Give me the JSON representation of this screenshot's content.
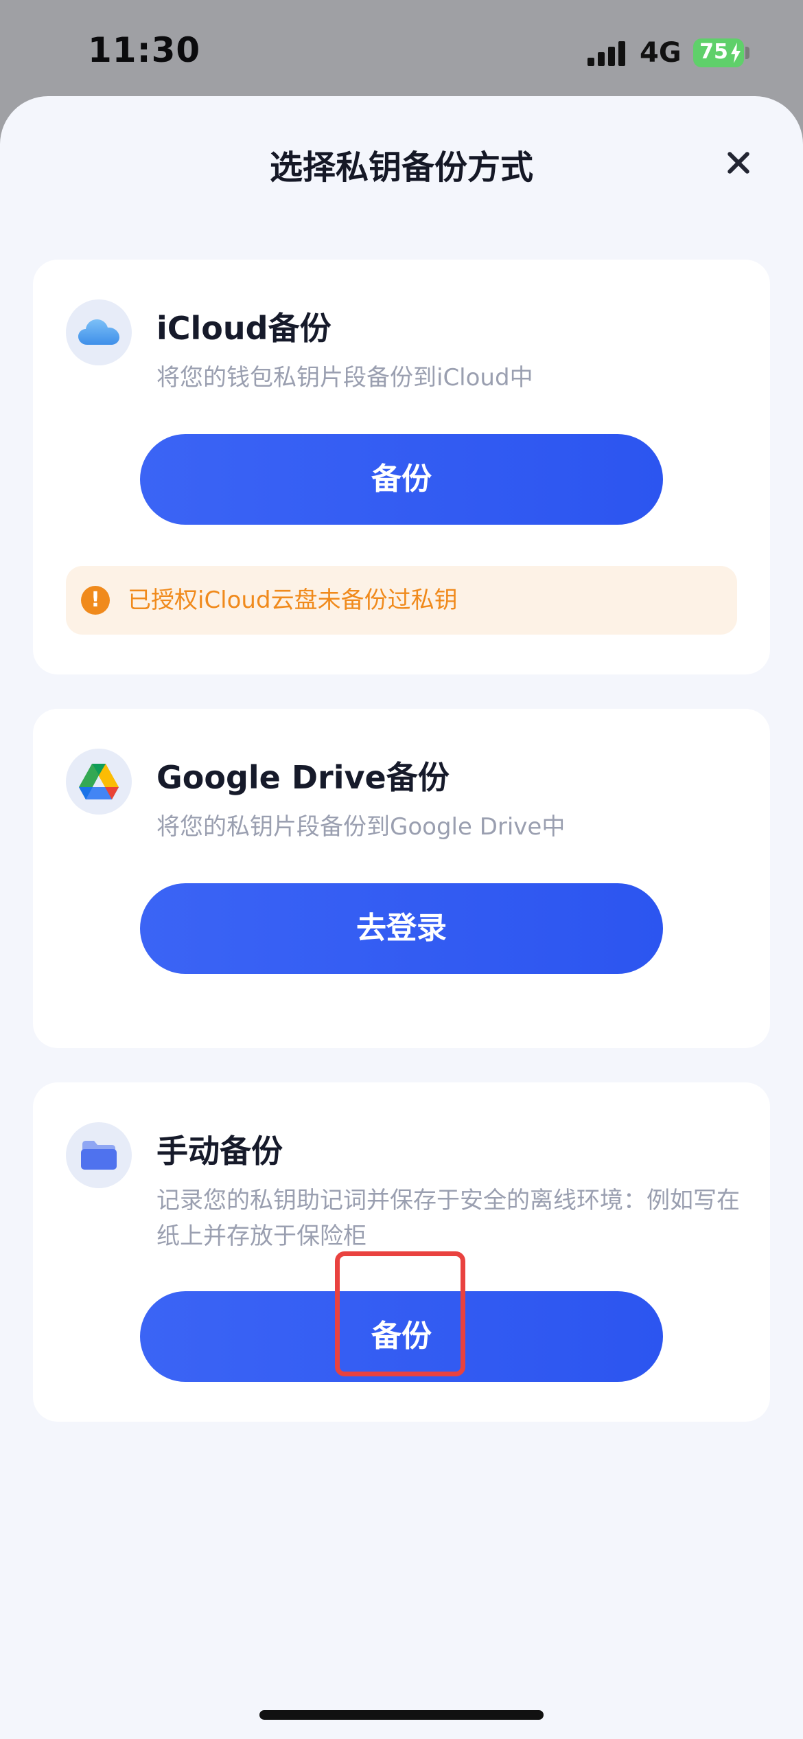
{
  "status_bar": {
    "time": "11:30",
    "network": "4G",
    "battery": "75",
    "signal_bars": 4,
    "battery_charging": true
  },
  "sheet": {
    "title": "选择私钥备份方式"
  },
  "icloud": {
    "title": "iCloud备份",
    "description": "将您的钱包私钥片段备份到iCloud中",
    "button": "备份",
    "notice": "已授权iCloud云盘未备份过私钥",
    "notice_icon": "!",
    "icon": "icloud-icon"
  },
  "google_drive": {
    "title": "Google Drive备份",
    "description": "将您的私钥片段备份到Google Drive中",
    "button": "去登录",
    "icon": "google-drive-icon"
  },
  "manual": {
    "title": "手动备份",
    "description": "记录您的私钥助记词并保存于安全的离线环境：例如写在纸上并存放于保险柜",
    "button": "备份",
    "icon": "folder-icon"
  },
  "colors": {
    "primary": "#2c55f0",
    "warning": "#f08a1c",
    "highlight": "#e9423f",
    "battery": "#5fd06a",
    "sheet_background": "#f4f6fc"
  }
}
